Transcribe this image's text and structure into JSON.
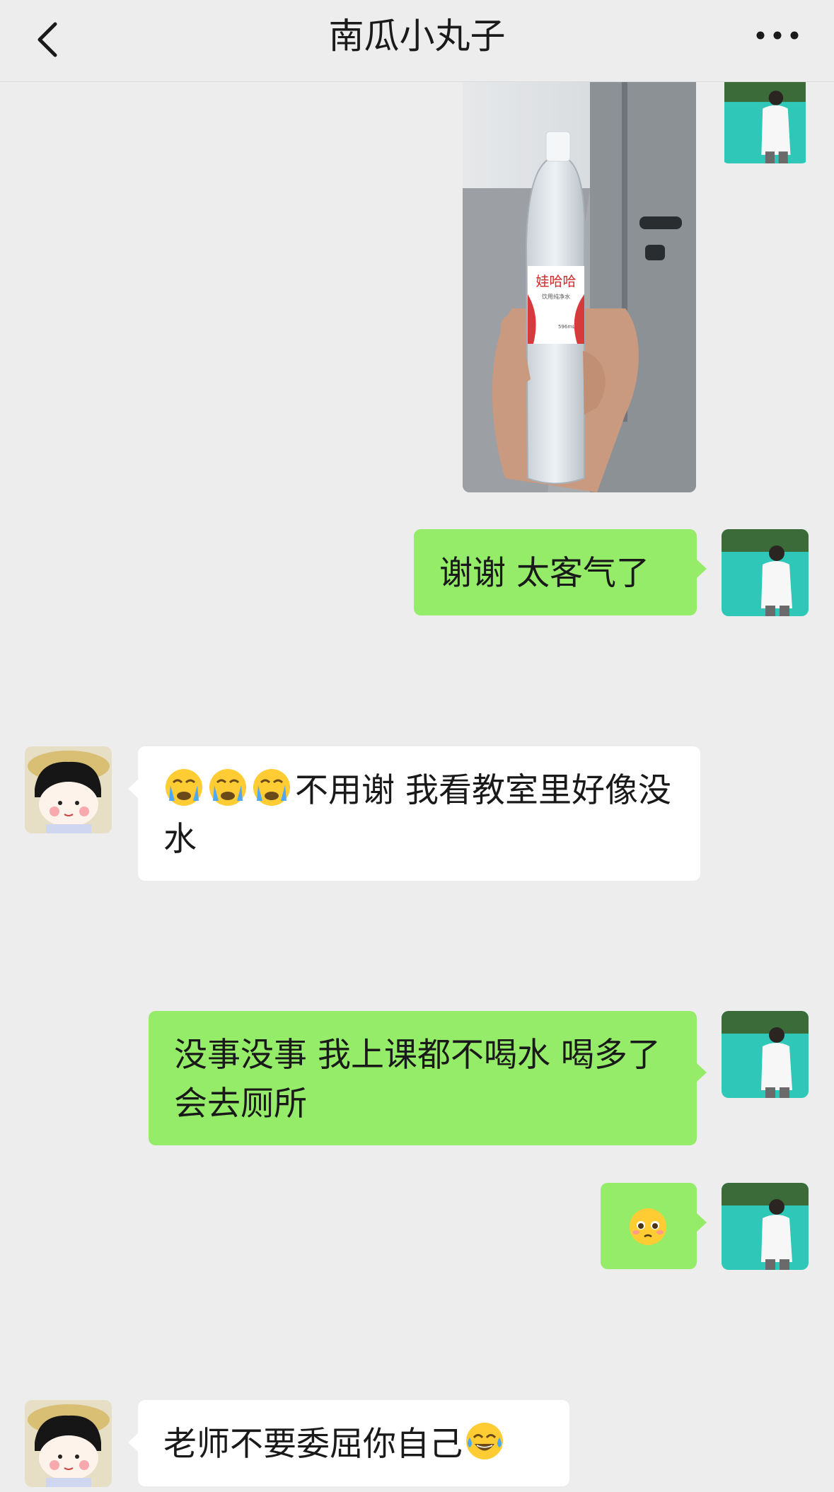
{
  "header": {
    "title": "南瓜小丸子",
    "back_icon": "chevron-left-icon",
    "more_icon": "more-dots-icon"
  },
  "messages": [
    {
      "sender": "me",
      "type": "image",
      "image_label": "娃哈哈",
      "image_sublabel": "饮用纯净水",
      "image_volume": "596mL"
    },
    {
      "sender": "me",
      "type": "text",
      "text": "谢谢 太客气了"
    },
    {
      "sender": "other",
      "type": "text",
      "emoji": [
        "crying-emoji",
        "crying-emoji",
        "crying-emoji"
      ],
      "text": "不用谢 我看教室里好像没水"
    },
    {
      "sender": "me",
      "type": "text",
      "text": "没事没事 我上课都不喝水 喝多了会去厕所"
    },
    {
      "sender": "me",
      "type": "emoji",
      "emoji": [
        "pleading-emoji"
      ]
    },
    {
      "sender": "other",
      "type": "text",
      "text": "老师不要委屈你自己",
      "emoji_after": [
        "tears-of-joy-emoji"
      ]
    }
  ],
  "colors": {
    "background": "#ededed",
    "my_bubble": "#95ec69",
    "other_bubble": "#ffffff",
    "text": "#191919"
  }
}
